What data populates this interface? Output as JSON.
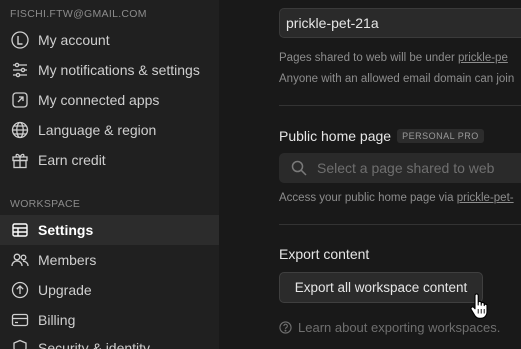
{
  "sidebar": {
    "account_email": "FISCHI.FTW@GMAIL.COM",
    "account_items": [
      {
        "label": "My account",
        "icon": "avatar-l-icon"
      },
      {
        "label": "My notifications & settings",
        "icon": "sliders-icon"
      },
      {
        "label": "My connected apps",
        "icon": "external-link-icon"
      },
      {
        "label": "Language & region",
        "icon": "globe-icon"
      },
      {
        "label": "Earn credit",
        "icon": "gift-icon"
      }
    ],
    "workspace_label": "WORKSPACE",
    "workspace_items": [
      {
        "label": "Settings",
        "icon": "grid-icon",
        "active": true
      },
      {
        "label": "Members",
        "icon": "people-icon"
      },
      {
        "label": "Upgrade",
        "icon": "arrow-up-circle-icon"
      },
      {
        "label": "Billing",
        "icon": "credit-card-icon"
      },
      {
        "label": "Security & identity",
        "icon": "shield-icon"
      }
    ]
  },
  "main": {
    "domain": {
      "value": "prickle-pet-21a",
      "help_line1_prefix": "Pages shared to web will be under ",
      "help_line1_link": "prickle-pe",
      "help_line2": "Anyone with an allowed email domain can join"
    },
    "public_home": {
      "title": "Public home page",
      "badge": "PERSONAL PRO",
      "search_placeholder": "Select a page shared to web",
      "help_prefix": "Access your public home page via ",
      "help_link": "prickle-pet-"
    },
    "export": {
      "title": "Export content",
      "button_label": "Export all workspace content",
      "learn_text": "Learn about exporting workspaces."
    }
  },
  "colors": {
    "sidebar_bg": "#202020",
    "main_bg": "#191919",
    "active_item_bg": "#2c2c2c"
  }
}
